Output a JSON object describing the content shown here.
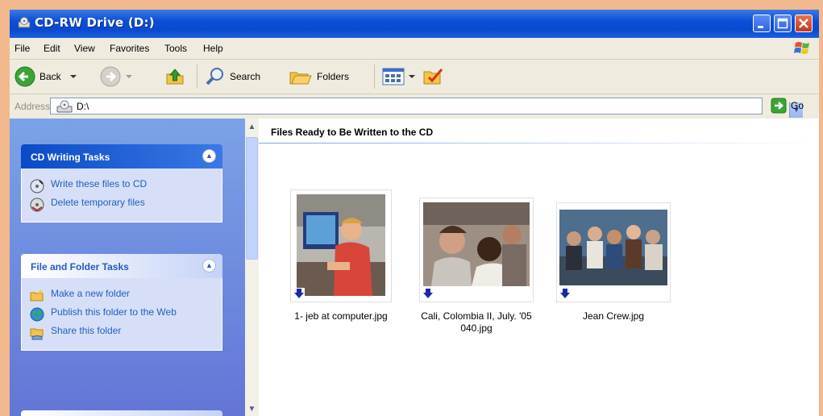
{
  "window": {
    "title": "CD-RW Drive (D:)"
  },
  "menu": [
    "File",
    "Edit",
    "View",
    "Favorites",
    "Tools",
    "Help"
  ],
  "toolbar": {
    "back": "Back",
    "search": "Search",
    "folders": "Folders"
  },
  "address": {
    "label": "Address",
    "value": "D:\\",
    "go": "Go"
  },
  "taskpane": {
    "cd_tasks": {
      "title": "CD Writing Tasks",
      "items": [
        "Write these files to CD",
        "Delete temporary files"
      ]
    },
    "file_tasks": {
      "title": "File and Folder Tasks",
      "items": [
        "Make a new folder",
        "Publish this folder to the Web",
        "Share this folder"
      ]
    }
  },
  "content": {
    "group_title": "Files Ready to Be Written to the CD",
    "files": [
      {
        "name": "1- jeb at computer.jpg"
      },
      {
        "name": "Cali, Colombia II, July. '05 040.jpg"
      },
      {
        "name": "Jean Crew.jpg"
      }
    ]
  },
  "colors": {
    "titlebar": "#0b4fd6",
    "taskpane": "#6d8ddf",
    "link": "#215dc6"
  }
}
